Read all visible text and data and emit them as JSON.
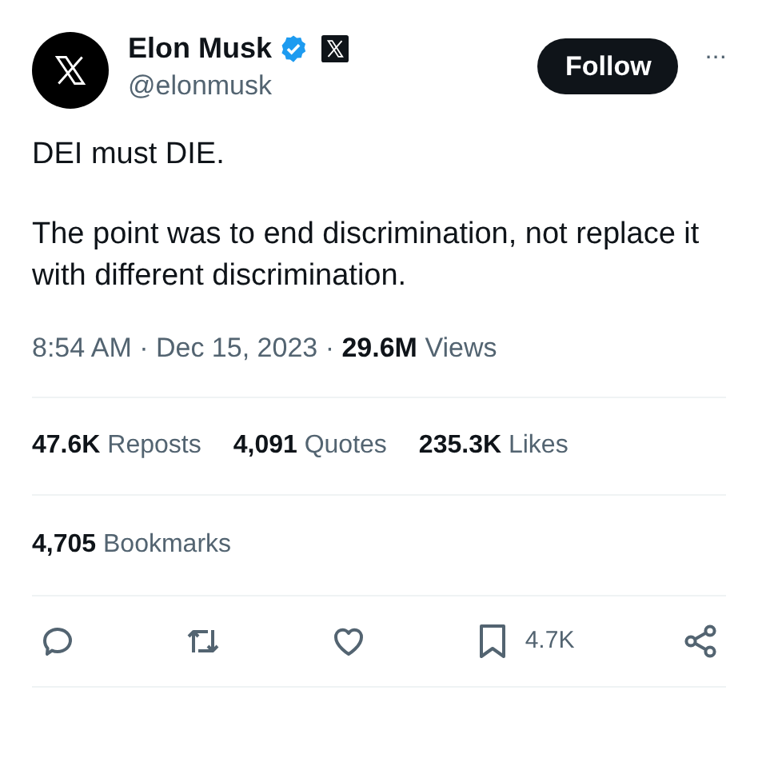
{
  "author": {
    "name": "Elon Musk",
    "handle": "@elonmusk",
    "verified": true
  },
  "follow_button": "Follow",
  "more_button": "···",
  "post_text": [
    "DEI must DIE.",
    "The point was to end discrimination, not replace it with different discrimination."
  ],
  "meta": "8:54 AM · Dec 15, 2023 · **29.6M** Views",
  "stats": [
    "**47.6K** Reposts",
    "**4,091** Quotes",
    "**235.3K** Likes"
  ],
  "bookmarks": "**4,705** Bookmarks",
  "actions": [
    {
      "kind": "reply"
    },
    {
      "kind": "repost"
    },
    {
      "kind": "like"
    },
    {
      "kind": "bookmark",
      "count": "4.7K"
    },
    {
      "kind": "share"
    }
  ]
}
